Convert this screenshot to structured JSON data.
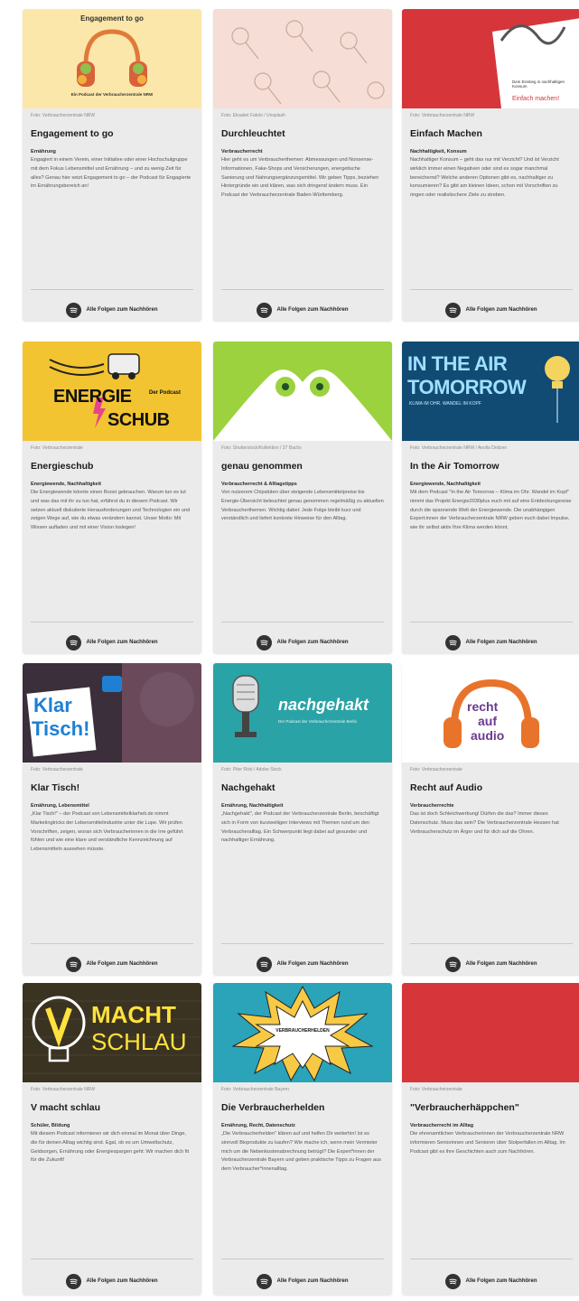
{
  "link_label": "Alle Folgen zum Nachhören",
  "colors": {
    "accent_red": "#d6363a",
    "card_bg": "#ebebeb",
    "accent_orange": "#e8742b"
  },
  "cards": [
    {
      "credit": "Foto: Verbraucherzentrale NRW",
      "title": "Engagement to go",
      "tags": "Ernährung",
      "desc": "Engagiert in einem Verein, einer Initiative oder einer Hochschulgruppe mit dem Fokus Lebensmittel und Ernährung – und zu wenig Zeit für alles? Genau hier setzt Engagement to go – der Podcast für Engagierte im Ernährungsbereich an!",
      "img_text": [
        "Engagement to go",
        "Ein Podcast der Verbraucherzentrale NRW"
      ]
    },
    {
      "credit": "Foto: Elisabet Fatolo / Unsplash",
      "title": "Durchleuchtet",
      "tags": "Verbraucherrecht",
      "desc": "Hier geht es um Verbraucherthemen: Abmessungen und Nonsense-Informationen, Fake-Shops und Versicherungen, energetische Sanierung und Nahrungsergänzungsmittel. Wir geben Tipps, beziehen Hintergründe ein und klären, was sich dringend ändern muss. Ein Podcast der Verbraucherzentrale Baden-Württemberg.",
      "img_text": []
    },
    {
      "credit": "Foto: Verbraucherzentrale NRW",
      "title": "Einfach Machen",
      "tags": "Nachhaltigkeit, Konsum",
      "desc": "Nachhaltiger Konsum – geht das nur mit Verzicht? Und ist Verzicht wirklich immer einen Negativen oder sind es sogar manchmal bereichernd? Welche anderen Optionen gibt es, nachhaltiger zu konsumieren? Es gibt am kleinen Ideen, schon mit Vorschriften zu ringen oder realistischere Ziele zu streben.",
      "img_text": [
        "Dein Einstieg in nachhaltigen Konsum",
        "Einfach machen!"
      ]
    },
    {
      "credit": "Foto: Verbraucherzentrale",
      "title": "Energieschub",
      "tags": "Energiewende, Nachhaltigkeit",
      "desc": "Die Energiewende könnte einen Boost gebrauchen. Warum tun es tut und was das mit ihr zu tun hat, erfährst du in diesem Podcast. Wir setzen aktuell diskutierte Herausforderungen und Technologien ein und zeigen Wege auf, wie du etwas verändern kannst. Unser Motto: Mit Wissen aufladen und mit einer Vision loslegen!",
      "img_text": [
        "ENERGIE",
        "SCHUB",
        "Der Podcast"
      ]
    },
    {
      "credit": "Foto: Shutterstock/Kollektion / 37 Bachs",
      "title": "genau genommen",
      "tags": "Verbraucherrecht & Alltagstipps",
      "desc": "Von nutzerem Chipstüten über steigende Lebensmittelpreise bis Energie-Übersicht beleuchtet genau genommen regelmäßig zu aktuellen Verbraucherthemen. Wichtig dabei: Jede Folge bleibt kurz und verständlich und liefert konkrete Hinweise für den Alltag.",
      "img_text": []
    },
    {
      "credit": "Foto: Verbraucherzentrale NRW / Anolla Deitzen",
      "title": "In the Air Tomorrow",
      "tags": "Energiewende, Nachhaltigkeit",
      "desc": "Mit dem Podcast \"In the Air Tomorrow – Klima im Ohr. Wandel im Kopf\" nimmt das Projekt Energie2030plus euch mit auf eine Entdeckungsreise durch die spannende Welt der Energiewende. Die unabhängigen Expert:innen der Verbraucherzentrale NRW geben euch dabei Impulse, wie ihr selbst aktiv Ihre Klima werden könnt.",
      "img_text": [
        "IN THE AIR",
        "TOMORROW",
        "KLIMA IM OHR. WANDEL IM KOPF"
      ]
    },
    {
      "credit": "Foto: Verbraucherzentrale",
      "title": "Klar Tisch!",
      "tags": "Ernährung, Lebensmittel",
      "desc": "„Klar Tisch!\" – der Podcast von Lebensmittelklarheit.de nimmt Marketingtricks der Lebensmittelindustrie unter die Lupe. Wir prüfen Vorschriften, zeigen, woran sich Verbraucherinnen in die Irre geführt fühlen und wie eine klare und verständliche Kennzeichnung auf Lebensmitteln aussehen müsste.",
      "img_text": [
        "Klar",
        "Tisch!"
      ]
    },
    {
      "credit": "Foto: Piter Rösl / Adobe Stock",
      "title": "Nachgehakt",
      "tags": "Ernährung, Nachhaltigkeit",
      "desc": "„Nachgehakt\", der Podcast der Verbraucherzentrale Berlin, beschäftigt sich in Form von kurzweiligen Interviews mit Themen rund um den Verbraucheralltag. Ein Schwerpunkt liegt dabei auf gesunder und nachhaltiger Ernährung.",
      "img_text": [
        "nachgehakt",
        "Der Podcast der Verbraucherzentrale Berlin"
      ]
    },
    {
      "credit": "Foto: Verbraucherzentrale",
      "title": "Recht auf Audio",
      "tags": "Verbraucherrechte",
      "desc": "Das ist doch Schleichwerbung! Dürfen die das? Immer dieses Datenschutz. Muss das sein? Die Verbraucherzentrale Hessen hat Verbraucherschutz im Ärger und für dich auf die Ohren.",
      "img_text": [
        "recht",
        "auf",
        "audio"
      ]
    },
    {
      "credit": "Foto: Verbraucherzentrale NRW",
      "title": "V macht schlau",
      "tags": "Schüler, Bildung",
      "desc": "Mit diesem Podcast informieren wir dich einmal im Monat über Dinge, die für deinen Alltag wichtig sind. Egal, ob es um Umweltschutz, Geldsorgen, Ernährung oder Energiespargen geht: Wir machen dich fit für die Zukunft!",
      "img_text": [
        "MACHT",
        "SCHLAU"
      ]
    },
    {
      "credit": "Foto: Verbraucherzentrale Bayern",
      "title": "Die Verbraucherhelden",
      "tags": "Ernährung, Recht, Datenschutz",
      "desc": "„Die Verbraucherhelden\" klären auf und helfen Dir weiterhin! Ist es sinnvoll Bioprodukte zu kaufen? Wie mache ich, wenn mein Vermieter mich um die Nebenkostenabrechnung betrügt? Die Expert*innen der Verbraucherzentrale Bayern und geben praktische Tipps zu Fragen aus dem Verbraucher*innenalltag.",
      "img_text": [
        "VERBRAUCHERHELDEN"
      ]
    },
    {
      "credit": "Foto: Verbraucherzentrale",
      "title": "\"Verbraucherhäppchen\"",
      "tags": "Verbraucherrecht im Alltag",
      "desc": "Die ehrenamtlichen Verbraucherinnen der Verbraucherzentrale NRW informieren Seniorinnen und Senioren über Stolperfallen im Alltag. Im Podcast gibt es ihre Geschichten auch zum Nachhören.",
      "img_text": []
    }
  ]
}
